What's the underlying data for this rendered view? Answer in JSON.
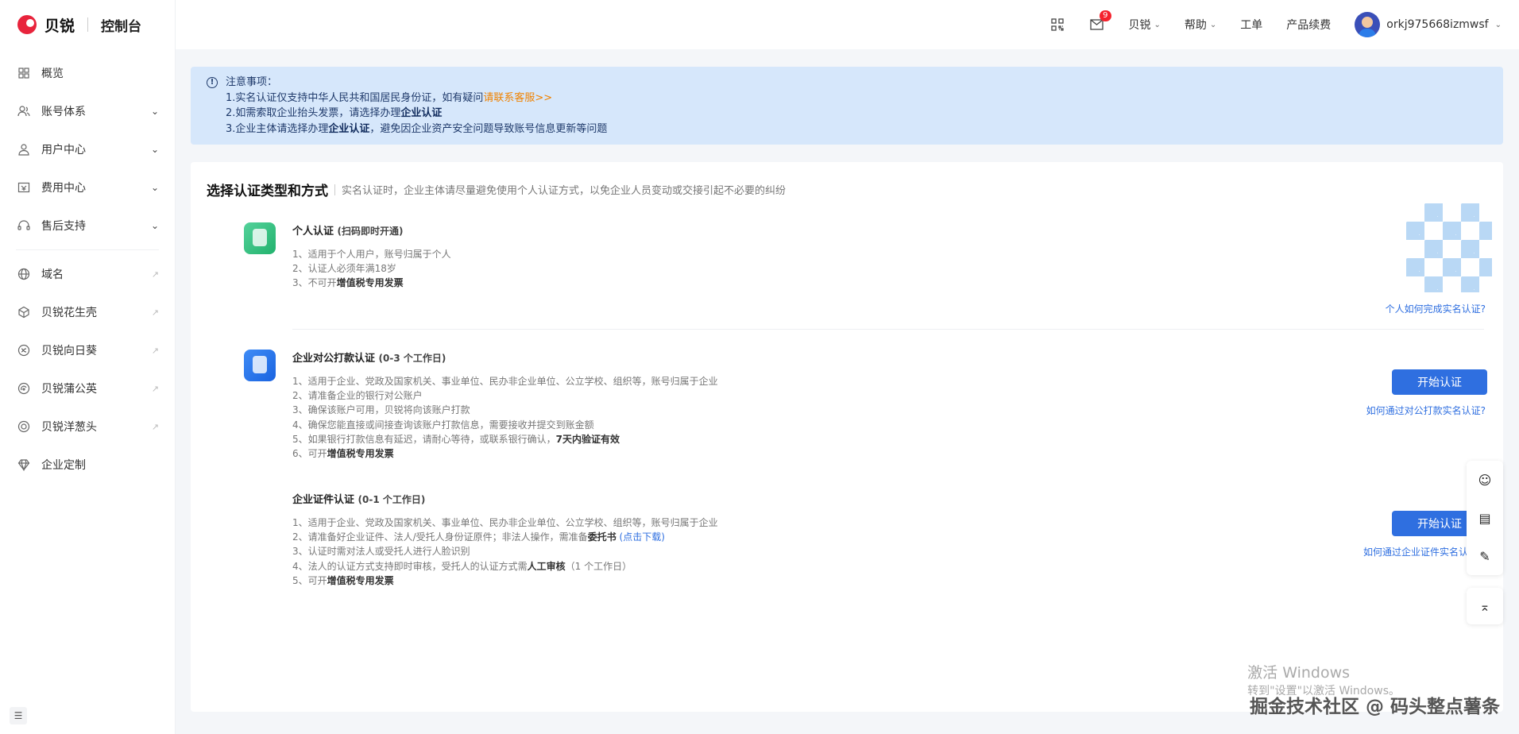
{
  "brand": {
    "name": "贝锐",
    "console": "控制台",
    "accent": "#e8243c"
  },
  "sidebar": {
    "items": [
      {
        "label": "概览",
        "icon": "grid-icon",
        "caret": false,
        "external": false
      },
      {
        "label": "账号体系",
        "icon": "user-group-icon",
        "caret": true,
        "external": false
      },
      {
        "label": "用户中心",
        "icon": "user-icon",
        "caret": true,
        "external": false
      },
      {
        "label": "费用中心",
        "icon": "wallet-icon",
        "caret": true,
        "external": false
      },
      {
        "label": "售后支持",
        "icon": "headset-icon",
        "caret": true,
        "external": false
      }
    ],
    "products": [
      {
        "label": "域名",
        "icon": "globe-icon",
        "external": true
      },
      {
        "label": "贝锐花生壳",
        "icon": "cube-icon",
        "external": true
      },
      {
        "label": "贝锐向日葵",
        "icon": "sunflower-icon",
        "external": true
      },
      {
        "label": "贝锐蒲公英",
        "icon": "dandelion-icon",
        "external": true
      },
      {
        "label": "贝锐洋葱头",
        "icon": "onion-icon",
        "external": true
      },
      {
        "label": "企业定制",
        "icon": "diamond-icon",
        "external": false
      }
    ]
  },
  "header": {
    "mail_badge": "9",
    "links": [
      "贝锐",
      "帮助",
      "工单",
      "产品续费"
    ],
    "user": "orkj975668izmwsf"
  },
  "notice": {
    "title": "注意事项：",
    "line1_prefix": "1.实名认证仅支持中华人民共和国居民身份证，如有疑问",
    "line1_link": "请联系客服>>",
    "line2_prefix": "2.如需索取企业抬头发票，请选择办理",
    "line2_bold": "企业认证",
    "line3_prefix": "3.企业主体请选择办理",
    "line3_bold": "企业认证",
    "line3_suffix": "，避免因企业资产安全问题导致账号信息更新等问题"
  },
  "card": {
    "title": "选择认证类型和方式",
    "subtitle": "实名认证时，企业主体请尽量避免使用个人认证方式，以免企业人员变动或交接引起不必要的纠纷"
  },
  "personal": {
    "title": "个人认证",
    "tag": "(扫码即时开通)",
    "lines": [
      "1、适用于个人用户，账号归属于个人",
      "2、认证人必须年满18岁"
    ],
    "line3_prefix": "3、不可开",
    "line3_bold": "增值税专用发票",
    "help": "个人如何完成实名认证?"
  },
  "bank": {
    "title": "企业对公打款认证",
    "tag": "(0-3 个工作日)",
    "lines": [
      "1、适用于企业、党政及国家机关、事业单位、民办非企业单位、公立学校、组织等，账号归属于企业",
      "2、请准备企业的银行对公账户",
      "3、确保该账户可用，贝锐将向该账户打款",
      "4、确保您能直接或间接查询该账户打款信息，需要接收并提交到账金额"
    ],
    "line5_prefix": "5、如果银行打款信息有延迟，请耐心等待，或联系银行确认，",
    "line5_bold": "7天内验证有效",
    "line6_prefix": "6、可开",
    "line6_bold": "增值税专用发票",
    "button": "开始认证",
    "help": "如何通过对公打款实名认证?"
  },
  "license": {
    "title": "企业证件认证",
    "tag": "(0-1 个工作日)",
    "line1": "1、适用于企业、党政及国家机关、事业单位、民办非企业单位、公立学校、组织等，账号归属于企业",
    "line2_prefix": "2、请准备好企业证件、法人/受托人身份证原件；非法人操作，需准备",
    "line2_bold": "委托书",
    "line2_link": "(点击下载)",
    "line3": "3、认证时需对法人或受托人进行人脸识别",
    "line4_prefix": "4、法人的认证方式支持即时审核，受托人的认证方式需",
    "line4_bold": "人工审核",
    "line4_suffix": "（1 个工作日）",
    "line5_prefix": "5、可开",
    "line5_bold": "增值税专用发票",
    "button": "开始认证",
    "help": "如何通过企业证件实名认"
  },
  "watermarks": {
    "windows_title": "激活 Windows",
    "windows_sub": "转到\"设置\"以激活 Windows。",
    "site": "掘金技术社区 @ 码头整点薯条"
  },
  "colors": {
    "primary": "#2f6fe0",
    "notice_bg": "#d6e7fb",
    "link_orange": "#f08200"
  }
}
